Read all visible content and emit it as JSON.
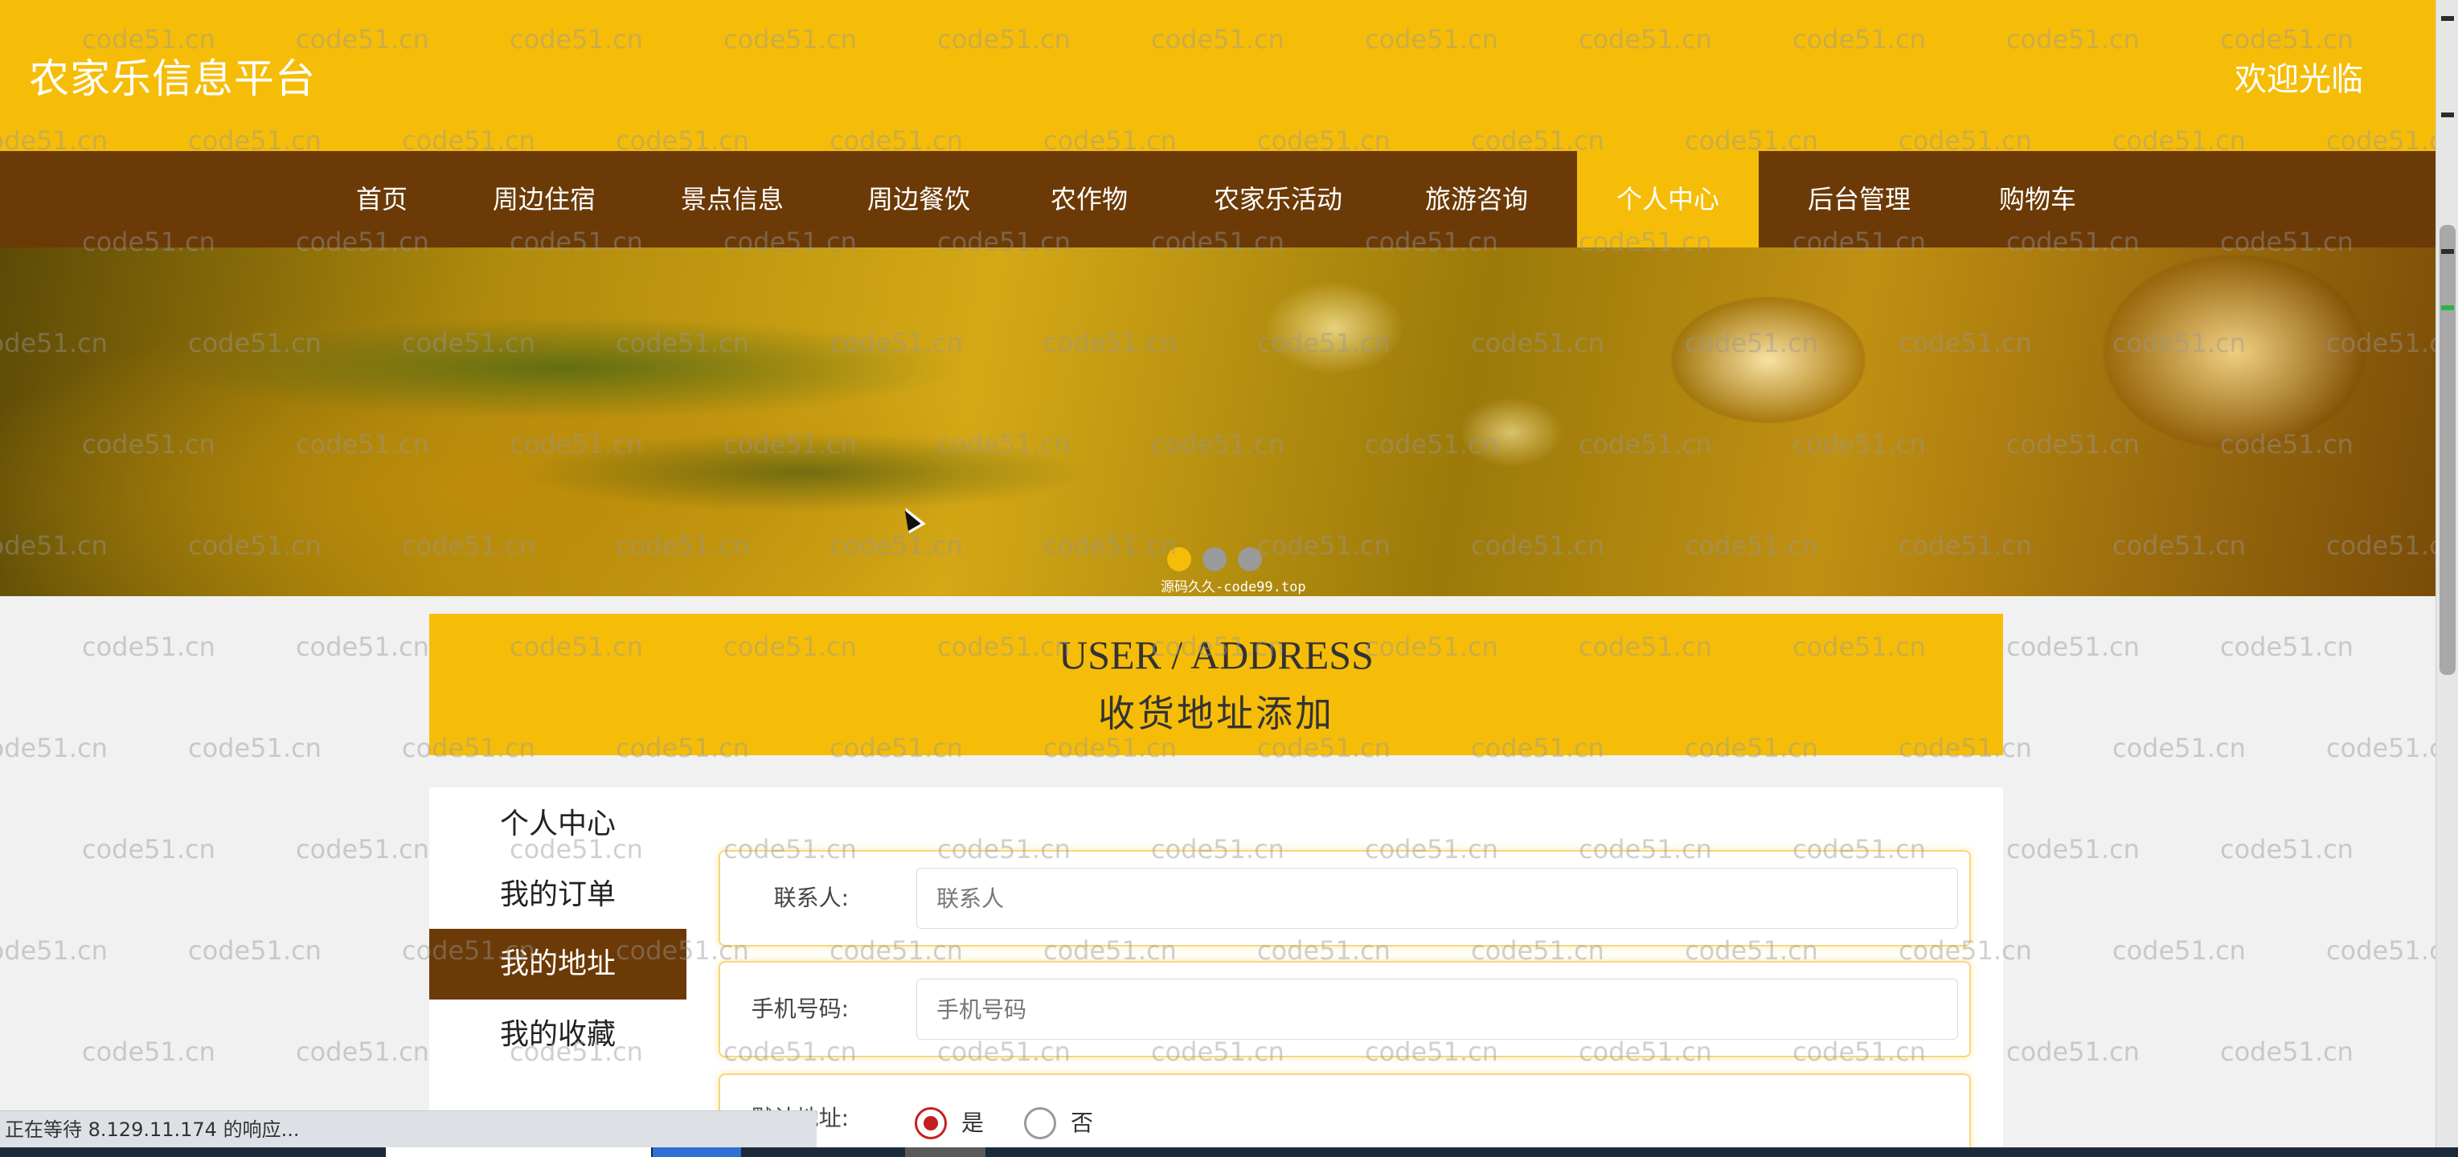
{
  "header": {
    "site_title": "农家乐信息平台",
    "welcome": "欢迎光临"
  },
  "nav": {
    "items": [
      {
        "label": "首页"
      },
      {
        "label": "周边住宿"
      },
      {
        "label": "景点信息"
      },
      {
        "label": "周边餐饮"
      },
      {
        "label": "农作物"
      },
      {
        "label": "农家乐活动"
      },
      {
        "label": "旅游咨询"
      },
      {
        "label": "个人中心",
        "active": true
      },
      {
        "label": "后台管理"
      },
      {
        "label": "购物车"
      }
    ]
  },
  "banner": {
    "caption": "源码久久-code99.top",
    "slide_count": 3,
    "active_slide": 1
  },
  "title_block": {
    "title_en": "USER / ADDRESS",
    "title_cn": "收货地址添加"
  },
  "sidebar": {
    "items": [
      {
        "label": "个人中心"
      },
      {
        "label": "我的订单"
      },
      {
        "label": "我的地址",
        "active": true
      },
      {
        "label": "我的收藏"
      }
    ]
  },
  "form": {
    "contact_label": "联系人:",
    "contact_placeholder": "联系人",
    "contact_value": "",
    "phone_label": "手机号码:",
    "phone_placeholder": "手机号码",
    "phone_value": "",
    "default_label": "默认地址:",
    "default_options": [
      {
        "label": "是",
        "checked": true
      },
      {
        "label": "否",
        "checked": false
      }
    ]
  },
  "watermark": "code51.cn",
  "status_bar": "正在等待 8.129.11.174 的响应...",
  "colors": {
    "primary_yellow": "#f6bd08",
    "nav_brown": "#6b3a07",
    "radio_red": "#c52020"
  }
}
